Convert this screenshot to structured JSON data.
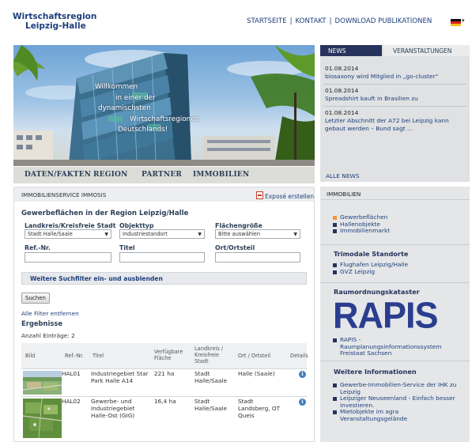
{
  "header": {
    "logo_line1": "Wirtschaftsregion",
    "logo_line2": "Leipzig-Halle",
    "nav": [
      "STARTSEITE",
      "KONTAKT",
      "DOWNLOAD PUBLIKATIONEN"
    ],
    "separator": "|"
  },
  "hero": {
    "lines": [
      "Willkommen",
      "in einer der",
      "dynamischsten",
      "Wirtschaftsregionen",
      "Deutschlands!"
    ]
  },
  "main_nav": [
    "DATEN/FAKTEN",
    "REGION",
    "PARTNER",
    "IMMOBILIEN"
  ],
  "news": {
    "tabs": [
      "NEWS",
      "VERANSTALTUNGEN"
    ],
    "items": [
      {
        "date": "01.08.2014",
        "title": "biosaxony wird Mitglied in „go-cluster“"
      },
      {
        "date": "01.08.2014",
        "title": "Spreadshirt kauft in Brasilien zu"
      },
      {
        "date": "01.08.2014",
        "title": "Letzter Abschnitt der A72 bei Leipzig kann gebaut werden – Bund sagt ..."
      }
    ],
    "all_label": "ALLE NEWS"
  },
  "immobilien_panel": {
    "header": "IMMOBILIEN",
    "links": [
      "Gewerbeflächen",
      "Hallenobjekte",
      "Immobilienmarkt"
    ],
    "trimodal_title": "Trimodale Standorte",
    "trimodal_links": [
      "Flughafen Leipzig/Halle",
      "GVZ Leipzig"
    ],
    "raum_title": "Raumordnungskataster",
    "rapis_logo": "RAPIS",
    "rapis_text": "RAPIS - Raumplanungsinformationssystem Freistaat Sachsen",
    "info_title": "Weitere Informationen",
    "info_links": [
      "Gewerbe-Immobilien-Service der IHK zu Leipzig",
      "Leipziger Neuseenland - Einfach besser investieren.",
      "Mietobjekte im agra Veranstaltungsgelände"
    ]
  },
  "content": {
    "header": "IMMOBILIENSERVICE IMMOSIS",
    "expose_label": "Exposé erstellen",
    "section_title": "Gewerbeflächen in der Region Leipzig/Halle",
    "filters": {
      "landkreis_label": "Landkreis/Kreisfreie Stadt",
      "landkreis_value": "Stadt Halle/Saale",
      "objekttyp_label": "Objekttyp",
      "objekttyp_value": "Industriestandort",
      "flaeche_label": "Flächengröße",
      "flaeche_value": "Bitte auswählen",
      "ref_label": "Ref.-Nr.",
      "titel_label": "Titel",
      "ort_label": "Ort/Ortsteil"
    },
    "toggle_label": "Weitere Suchfilter ein- und ausblenden",
    "search_button": "Suchen",
    "remove_filters": "Alle Filter entfernen",
    "results_title": "Ergebnisse",
    "results_count": "Anzahl Einträge: 2",
    "table": {
      "headers": {
        "bild": "Bild",
        "ref": "Ref.-Nr.",
        "titel": "Titel",
        "flaeche": "Verfügbare Fläche",
        "landkreis": "Landkreis / Kreisfreie Stadt",
        "ort": "Ort / Ortsteil",
        "details": "Details"
      },
      "rows": [
        {
          "ref": "HAL01",
          "titel": "Industriegebiet Star Park Halle A14",
          "flaeche": "221 ha",
          "landkreis": "Stadt Halle/Saale",
          "ort": "Halle (Saale)"
        },
        {
          "ref": "HAL02",
          "titel": "Gewerbe- und Industriegebiet Halle-Ost (GIG)",
          "flaeche": "16,4 ha",
          "landkreis": "Stadt Halle/Saale",
          "ort": "Stadt Landsberg, OT Queis"
        }
      ]
    }
  },
  "colors": {
    "brand_blue": "#1d3f7c",
    "dark_navy": "#26335c",
    "accent_orange": "#f29a2e",
    "rapis_blue": "#2a3d8f"
  },
  "icons": [
    "pdf-icon",
    "info-icon",
    "flag-icon",
    "chevron-down-icon"
  ]
}
